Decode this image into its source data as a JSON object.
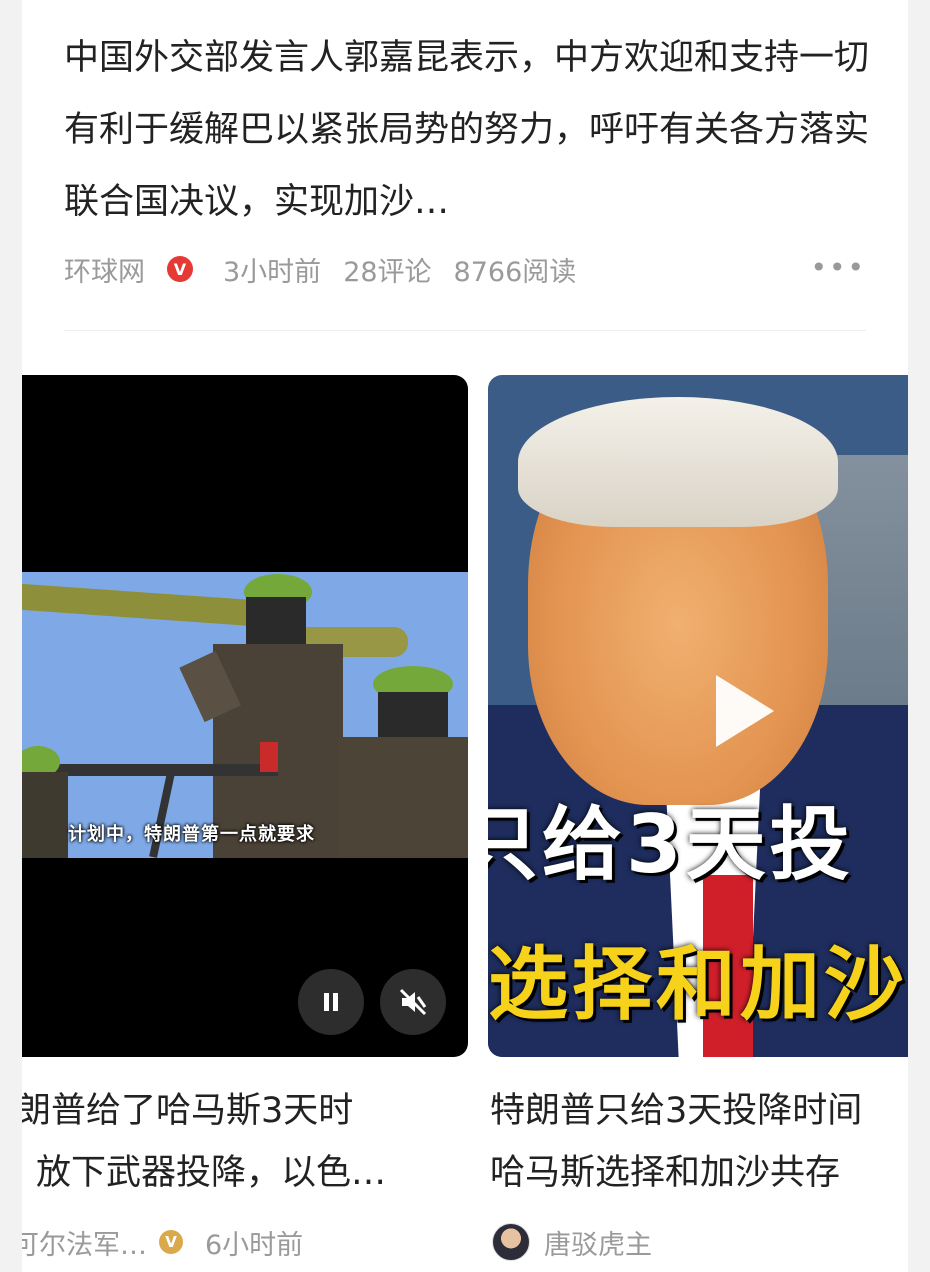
{
  "top_article": {
    "title": "中国外交部发言人郭嘉昆表示，中方欢迎和支持一切有利于缓解巴以紧张局势的努力，呼吁有关各方落实联合国决议，实现加沙…",
    "source": "环球网",
    "verified_badge": "V",
    "time": "3小时前",
    "comments": "28评论",
    "reads": "8766阅读",
    "more_icon": "more-dots-icon"
  },
  "left_card": {
    "subtitle": "计划中，特朗普第一点就要求",
    "title_line1": "朗普给了哈马斯3天时",
    "title_line2": "放下武器投降，以色…",
    "source": "可尔法军…",
    "badge": "V",
    "time": "6小时前",
    "controls": {
      "pause": "pause-icon",
      "mute": "mute-icon"
    }
  },
  "right_card": {
    "overlay_line1": "只给3天投",
    "overlay_line2": "选择和加沙",
    "title_line1": "特朗普只给3天投降时间",
    "title_line2": "哈马斯选择和加沙共存",
    "author": "唐驳虎主",
    "play_icon": "play-icon"
  },
  "colors": {
    "verified_red": "#e53935",
    "gold_badge": "#d9a94b",
    "overlay_yellow": "#f7d21b",
    "meta_gray": "#9a9a9a"
  }
}
